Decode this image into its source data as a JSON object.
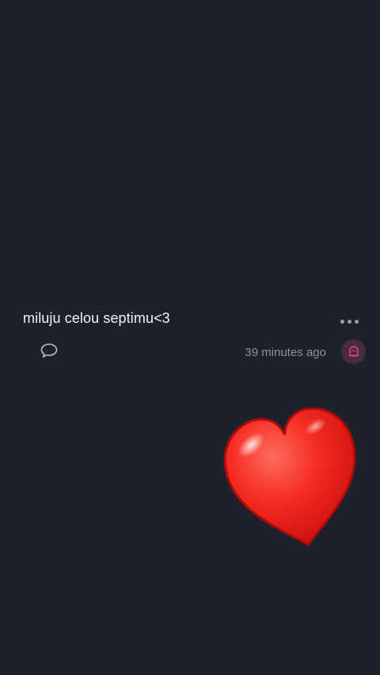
{
  "post": {
    "text": "miluju celou septimu<3",
    "timestamp": "39 minutes ago"
  },
  "icons": {
    "more": "more-options-icon",
    "comment": "comment-bubble-icon",
    "reaction": "ghost-reaction-icon",
    "sticker": "red-heart-emoji"
  },
  "colors": {
    "background": "#1c212b",
    "text": "#f2f3f5",
    "muted": "#8d929b",
    "accent_pink": "#e0457f",
    "heart_red": "#e8231f"
  }
}
